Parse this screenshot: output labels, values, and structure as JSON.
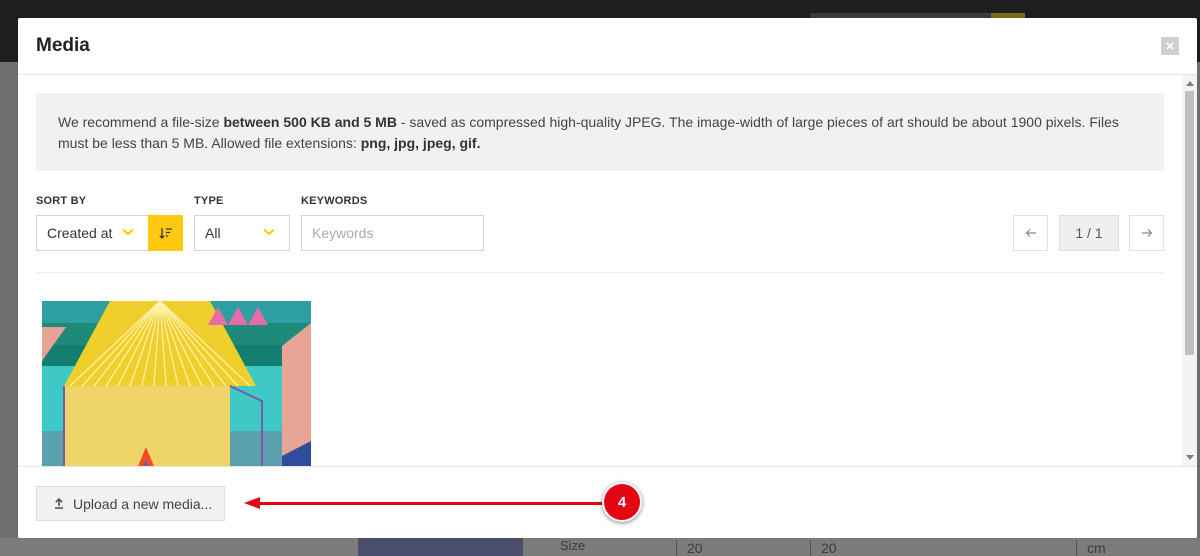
{
  "modal": {
    "title": "Media",
    "info": {
      "t1": "We recommend a file-size ",
      "b1": "between 500 KB and 5 MB",
      "t2": " - saved as compressed high-quality JPEG. The image-width of large pieces of art should be about 1900 pixels. Files must be less than 5 MB. Allowed file extensions: ",
      "b2": "png, jpg, jpeg, gif."
    },
    "filters": {
      "sort_label": "SORT BY",
      "sort_value": "Created at",
      "type_label": "TYPE",
      "type_value": "All",
      "keywords_label": "KEYWORDS",
      "keywords_placeholder": "Keywords",
      "keywords_value": ""
    },
    "pagination": {
      "counter": "1 / 1"
    },
    "footer": {
      "upload_label": "Upload a new media..."
    }
  },
  "annotation": {
    "step": "4"
  },
  "background": {
    "size_label": "Size",
    "field1": "20",
    "field2": "20",
    "unit": "cm"
  },
  "icons": {
    "close": "close-icon",
    "sort": "sort-order-icon",
    "prev": "arrow-left-icon",
    "next": "arrow-right-icon",
    "upload": "upload-icon",
    "chevron": "chevron-down-icon"
  },
  "colors": {
    "accent": "#ffc90f",
    "annotation": "#e30613",
    "overlay": "#6e6e6e"
  }
}
